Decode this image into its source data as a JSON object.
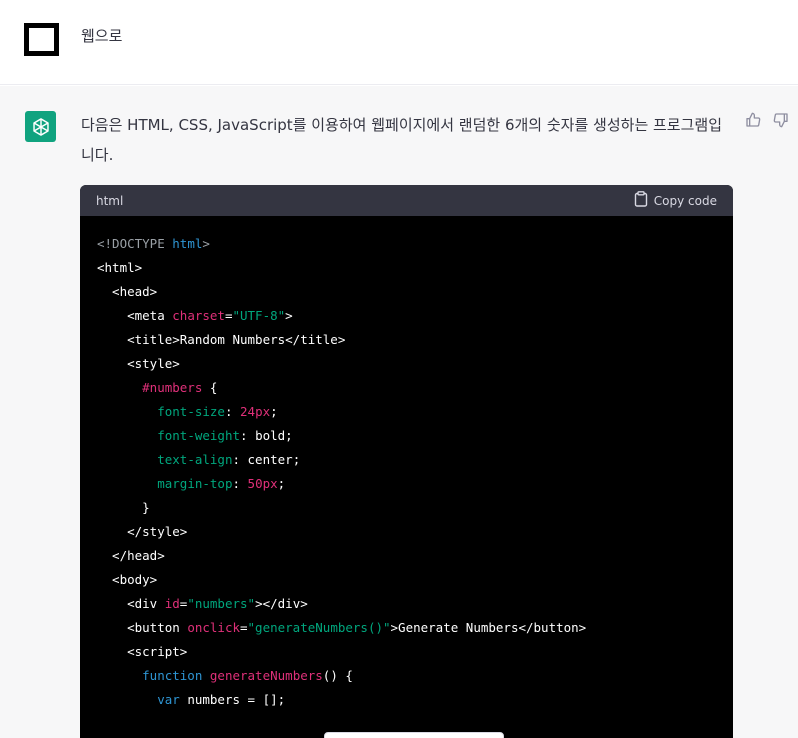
{
  "user": {
    "message": "웹으로"
  },
  "assistant": {
    "message": "다음은 HTML, CSS, JavaScript를 이용하여 웹페이지에서 랜덤한 6개의 숫자를 생성하는 프로그램입니다.",
    "code_lang": "html",
    "copy_label": "Copy code"
  },
  "code_lines": [
    [
      {
        "t": "<!DOCTYPE ",
        "c": "gray"
      },
      {
        "t": "html",
        "c": "blue"
      },
      {
        "t": ">",
        "c": "gray"
      }
    ],
    [
      {
        "t": "<html>",
        "c": "white"
      }
    ],
    [
      {
        "t": "  <head>",
        "c": "white"
      }
    ],
    [
      {
        "t": "    <meta ",
        "c": "white"
      },
      {
        "t": "charset",
        "c": "red"
      },
      {
        "t": "=",
        "c": "white"
      },
      {
        "t": "\"UTF-8\"",
        "c": "green"
      },
      {
        "t": ">",
        "c": "white"
      }
    ],
    [
      {
        "t": "    <title>Random Numbers</title>",
        "c": "white"
      }
    ],
    [
      {
        "t": "    <style>",
        "c": "white"
      }
    ],
    [
      {
        "t": "      ",
        "c": "white"
      },
      {
        "t": "#numbers",
        "c": "red"
      },
      {
        "t": " {",
        "c": "white"
      }
    ],
    [
      {
        "t": "        ",
        "c": "white"
      },
      {
        "t": "font-size",
        "c": "green"
      },
      {
        "t": ": ",
        "c": "white"
      },
      {
        "t": "24px",
        "c": "red"
      },
      {
        "t": ";",
        "c": "white"
      }
    ],
    [
      {
        "t": "        ",
        "c": "white"
      },
      {
        "t": "font-weight",
        "c": "green"
      },
      {
        "t": ": bold;",
        "c": "white"
      }
    ],
    [
      {
        "t": "        ",
        "c": "white"
      },
      {
        "t": "text-align",
        "c": "green"
      },
      {
        "t": ": center;",
        "c": "white"
      }
    ],
    [
      {
        "t": "        ",
        "c": "white"
      },
      {
        "t": "margin-top",
        "c": "green"
      },
      {
        "t": ": ",
        "c": "white"
      },
      {
        "t": "50px",
        "c": "red"
      },
      {
        "t": ";",
        "c": "white"
      }
    ],
    [
      {
        "t": "      }",
        "c": "white"
      }
    ],
    [
      {
        "t": "    </style>",
        "c": "white"
      }
    ],
    [
      {
        "t": "  </head>",
        "c": "white"
      }
    ],
    [
      {
        "t": "  <body>",
        "c": "white"
      }
    ],
    [
      {
        "t": "    <div ",
        "c": "white"
      },
      {
        "t": "id",
        "c": "red"
      },
      {
        "t": "=",
        "c": "white"
      },
      {
        "t": "\"numbers\"",
        "c": "green"
      },
      {
        "t": "></div>",
        "c": "white"
      }
    ],
    [
      {
        "t": "    <button ",
        "c": "white"
      },
      {
        "t": "onclick",
        "c": "red"
      },
      {
        "t": "=",
        "c": "white"
      },
      {
        "t": "\"generateNumbers()\"",
        "c": "green"
      },
      {
        "t": ">Generate Numbers</button>",
        "c": "white"
      }
    ],
    [
      {
        "t": "    <script>",
        "c": "white"
      }
    ],
    [
      {
        "t": "      ",
        "c": "white"
      },
      {
        "t": "function",
        "c": "blue"
      },
      {
        "t": " ",
        "c": "white"
      },
      {
        "t": "generateNumbers",
        "c": "red"
      },
      {
        "t": "() {",
        "c": "white"
      }
    ],
    [
      {
        "t": "        ",
        "c": "white"
      },
      {
        "t": "var",
        "c": "blue"
      },
      {
        "t": " numbers = [];",
        "c": "white"
      }
    ]
  ],
  "colors": {
    "accent": "#10a37f",
    "code_bg": "#000000",
    "code_header_bg": "#343541"
  },
  "icons": {
    "user_avatar": "square-avatar-icon",
    "assistant_avatar": "openai-logo-icon",
    "copy": "clipboard-icon",
    "thumbs_up": "thumbs-up-icon",
    "thumbs_down": "thumbs-down-icon"
  }
}
